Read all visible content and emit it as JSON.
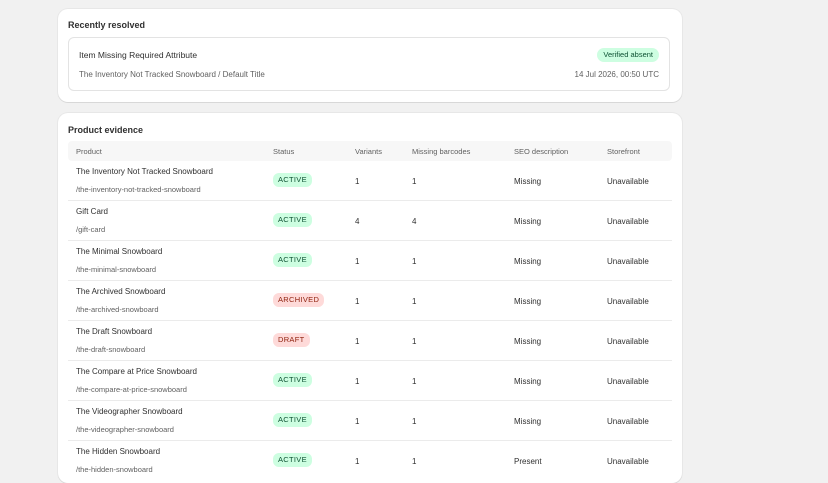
{
  "resolved": {
    "title": "Recently resolved",
    "issue": "Item Missing Required Attribute",
    "badge": "Verified absent",
    "product": "The Inventory Not Tracked Snowboard / Default Title",
    "timestamp": "14 Jul 2026, 00:50 UTC"
  },
  "evidence": {
    "title": "Product evidence",
    "columns": {
      "product": "Product",
      "status": "Status",
      "variants": "Variants",
      "missing": "Missing barcodes",
      "seo": "SEO description",
      "storefront": "Storefront"
    },
    "rows": [
      {
        "name": "The Inventory Not Tracked Snowboard",
        "handle": "/the-inventory-not-tracked-snowboard",
        "status": "ACTIVE",
        "variants": "1",
        "missing": "1",
        "seo": "Missing",
        "storefront": "Unavailable"
      },
      {
        "name": "Gift Card",
        "handle": "/gift-card",
        "status": "ACTIVE",
        "variants": "4",
        "missing": "4",
        "seo": "Missing",
        "storefront": "Unavailable"
      },
      {
        "name": "The Minimal Snowboard",
        "handle": "/the-minimal-snowboard",
        "status": "ACTIVE",
        "variants": "1",
        "missing": "1",
        "seo": "Missing",
        "storefront": "Unavailable"
      },
      {
        "name": "The Archived Snowboard",
        "handle": "/the-archived-snowboard",
        "status": "ARCHIVED",
        "variants": "1",
        "missing": "1",
        "seo": "Missing",
        "storefront": "Unavailable"
      },
      {
        "name": "The Draft Snowboard",
        "handle": "/the-draft-snowboard",
        "status": "DRAFT",
        "variants": "1",
        "missing": "1",
        "seo": "Missing",
        "storefront": "Unavailable"
      },
      {
        "name": "The Compare at Price Snowboard",
        "handle": "/the-compare-at-price-snowboard",
        "status": "ACTIVE",
        "variants": "1",
        "missing": "1",
        "seo": "Missing",
        "storefront": "Unavailable"
      },
      {
        "name": "The Videographer Snowboard",
        "handle": "/the-videographer-snowboard",
        "status": "ACTIVE",
        "variants": "1",
        "missing": "1",
        "seo": "Missing",
        "storefront": "Unavailable"
      },
      {
        "name": "The Hidden Snowboard",
        "handle": "/the-hidden-snowboard",
        "status": "ACTIVE",
        "variants": "1",
        "missing": "1",
        "seo": "Present",
        "storefront": "Unavailable"
      }
    ]
  },
  "colors": {
    "active_bg": "#cdfee1",
    "active_fg": "#0c5132",
    "archived_bg": "#fedad9",
    "archived_fg": "#8e1f0b"
  }
}
